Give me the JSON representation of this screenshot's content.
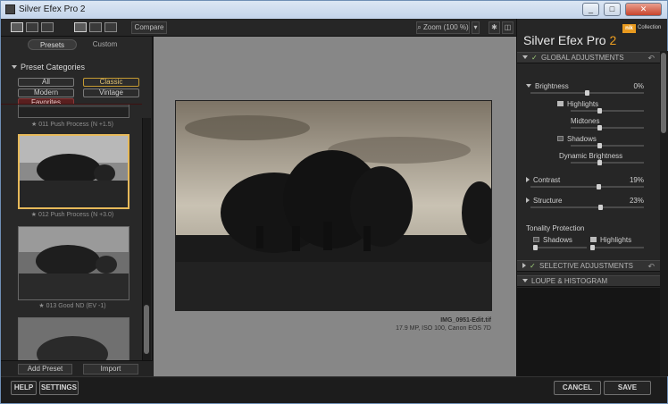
{
  "window": {
    "title": "Silver Efex Pro 2",
    "min_glyph": "_",
    "max_glyph": "□",
    "close_glyph": "✕"
  },
  "toolbar": {
    "compare_label": "Compare",
    "zoom_label": "Zoom (100 %)"
  },
  "left": {
    "tabs": [
      "Presets",
      "Custom"
    ],
    "categories_title": "Preset Categories",
    "categories": [
      "All",
      "Classic",
      "Modern",
      "Vintage",
      "Favorites"
    ],
    "selected_category": "Classic",
    "presets": [
      "★ 011 Push Process (N +1.5)",
      "★ 012 Push Process (N +3.0)",
      "★ 013 Good ND (EV -1)"
    ],
    "add_preset_label": "Add Preset",
    "import_label": "Import"
  },
  "image": {
    "filename": "IMG_0951-Edit.tif",
    "meta": "17.9 MP, ISO 100, Canon EOS 7D"
  },
  "right": {
    "brand": "Silver Efex Pro",
    "brand_version": "2",
    "nik_badge": "nik",
    "nik_text": "Collection",
    "global_title": "GLOBAL ADJUSTMENTS",
    "brightness": {
      "label": "Brightness",
      "value": "0%"
    },
    "highlights": "Highlights",
    "midtones": "Midtones",
    "shadows": "Shadows",
    "dynamic_brightness": "Dynamic Brightness",
    "contrast": {
      "label": "Contrast",
      "value": "19%"
    },
    "structure": {
      "label": "Structure",
      "value": "23%"
    },
    "tonality": {
      "label": "Tonality Protection",
      "shadows": "Shadows",
      "highlights": "Highlights"
    },
    "selective_title": "SELECTIVE ADJUSTMENTS",
    "loupe_title": "LOUPE & HISTOGRAM"
  },
  "bottom": {
    "help": "HELP",
    "settings": "SETTINGS",
    "cancel": "CANCEL",
    "save": "SAVE"
  },
  "colors": {
    "accent": "#f0a020",
    "selected_border": "#e6b95a",
    "favorites": "#5a1f1f"
  }
}
